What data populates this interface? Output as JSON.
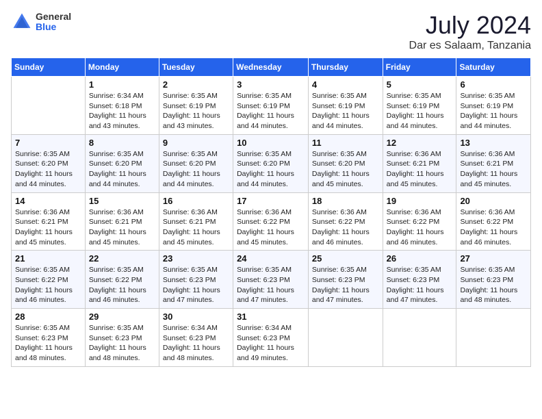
{
  "header": {
    "logo": {
      "general": "General",
      "blue": "Blue"
    },
    "title": "July 2024",
    "location": "Dar es Salaam, Tanzania"
  },
  "weekdays": [
    "Sunday",
    "Monday",
    "Tuesday",
    "Wednesday",
    "Thursday",
    "Friday",
    "Saturday"
  ],
  "weeks": [
    [
      {
        "day": "",
        "info": ""
      },
      {
        "day": "1",
        "info": "Sunrise: 6:34 AM\nSunset: 6:18 PM\nDaylight: 11 hours\nand 43 minutes."
      },
      {
        "day": "2",
        "info": "Sunrise: 6:35 AM\nSunset: 6:19 PM\nDaylight: 11 hours\nand 43 minutes."
      },
      {
        "day": "3",
        "info": "Sunrise: 6:35 AM\nSunset: 6:19 PM\nDaylight: 11 hours\nand 44 minutes."
      },
      {
        "day": "4",
        "info": "Sunrise: 6:35 AM\nSunset: 6:19 PM\nDaylight: 11 hours\nand 44 minutes."
      },
      {
        "day": "5",
        "info": "Sunrise: 6:35 AM\nSunset: 6:19 PM\nDaylight: 11 hours\nand 44 minutes."
      },
      {
        "day": "6",
        "info": "Sunrise: 6:35 AM\nSunset: 6:19 PM\nDaylight: 11 hours\nand 44 minutes."
      }
    ],
    [
      {
        "day": "7",
        "info": "Sunrise: 6:35 AM\nSunset: 6:20 PM\nDaylight: 11 hours\nand 44 minutes."
      },
      {
        "day": "8",
        "info": "Sunrise: 6:35 AM\nSunset: 6:20 PM\nDaylight: 11 hours\nand 44 minutes."
      },
      {
        "day": "9",
        "info": "Sunrise: 6:35 AM\nSunset: 6:20 PM\nDaylight: 11 hours\nand 44 minutes."
      },
      {
        "day": "10",
        "info": "Sunrise: 6:35 AM\nSunset: 6:20 PM\nDaylight: 11 hours\nand 44 minutes."
      },
      {
        "day": "11",
        "info": "Sunrise: 6:35 AM\nSunset: 6:20 PM\nDaylight: 11 hours\nand 45 minutes."
      },
      {
        "day": "12",
        "info": "Sunrise: 6:36 AM\nSunset: 6:21 PM\nDaylight: 11 hours\nand 45 minutes."
      },
      {
        "day": "13",
        "info": "Sunrise: 6:36 AM\nSunset: 6:21 PM\nDaylight: 11 hours\nand 45 minutes."
      }
    ],
    [
      {
        "day": "14",
        "info": "Sunrise: 6:36 AM\nSunset: 6:21 PM\nDaylight: 11 hours\nand 45 minutes."
      },
      {
        "day": "15",
        "info": "Sunrise: 6:36 AM\nSunset: 6:21 PM\nDaylight: 11 hours\nand 45 minutes."
      },
      {
        "day": "16",
        "info": "Sunrise: 6:36 AM\nSunset: 6:21 PM\nDaylight: 11 hours\nand 45 minutes."
      },
      {
        "day": "17",
        "info": "Sunrise: 6:36 AM\nSunset: 6:22 PM\nDaylight: 11 hours\nand 45 minutes."
      },
      {
        "day": "18",
        "info": "Sunrise: 6:36 AM\nSunset: 6:22 PM\nDaylight: 11 hours\nand 46 minutes."
      },
      {
        "day": "19",
        "info": "Sunrise: 6:36 AM\nSunset: 6:22 PM\nDaylight: 11 hours\nand 46 minutes."
      },
      {
        "day": "20",
        "info": "Sunrise: 6:36 AM\nSunset: 6:22 PM\nDaylight: 11 hours\nand 46 minutes."
      }
    ],
    [
      {
        "day": "21",
        "info": "Sunrise: 6:35 AM\nSunset: 6:22 PM\nDaylight: 11 hours\nand 46 minutes."
      },
      {
        "day": "22",
        "info": "Sunrise: 6:35 AM\nSunset: 6:22 PM\nDaylight: 11 hours\nand 46 minutes."
      },
      {
        "day": "23",
        "info": "Sunrise: 6:35 AM\nSunset: 6:23 PM\nDaylight: 11 hours\nand 47 minutes."
      },
      {
        "day": "24",
        "info": "Sunrise: 6:35 AM\nSunset: 6:23 PM\nDaylight: 11 hours\nand 47 minutes."
      },
      {
        "day": "25",
        "info": "Sunrise: 6:35 AM\nSunset: 6:23 PM\nDaylight: 11 hours\nand 47 minutes."
      },
      {
        "day": "26",
        "info": "Sunrise: 6:35 AM\nSunset: 6:23 PM\nDaylight: 11 hours\nand 47 minutes."
      },
      {
        "day": "27",
        "info": "Sunrise: 6:35 AM\nSunset: 6:23 PM\nDaylight: 11 hours\nand 48 minutes."
      }
    ],
    [
      {
        "day": "28",
        "info": "Sunrise: 6:35 AM\nSunset: 6:23 PM\nDaylight: 11 hours\nand 48 minutes."
      },
      {
        "day": "29",
        "info": "Sunrise: 6:35 AM\nSunset: 6:23 PM\nDaylight: 11 hours\nand 48 minutes."
      },
      {
        "day": "30",
        "info": "Sunrise: 6:34 AM\nSunset: 6:23 PM\nDaylight: 11 hours\nand 48 minutes."
      },
      {
        "day": "31",
        "info": "Sunrise: 6:34 AM\nSunset: 6:23 PM\nDaylight: 11 hours\nand 49 minutes."
      },
      {
        "day": "",
        "info": ""
      },
      {
        "day": "",
        "info": ""
      },
      {
        "day": "",
        "info": ""
      }
    ]
  ]
}
